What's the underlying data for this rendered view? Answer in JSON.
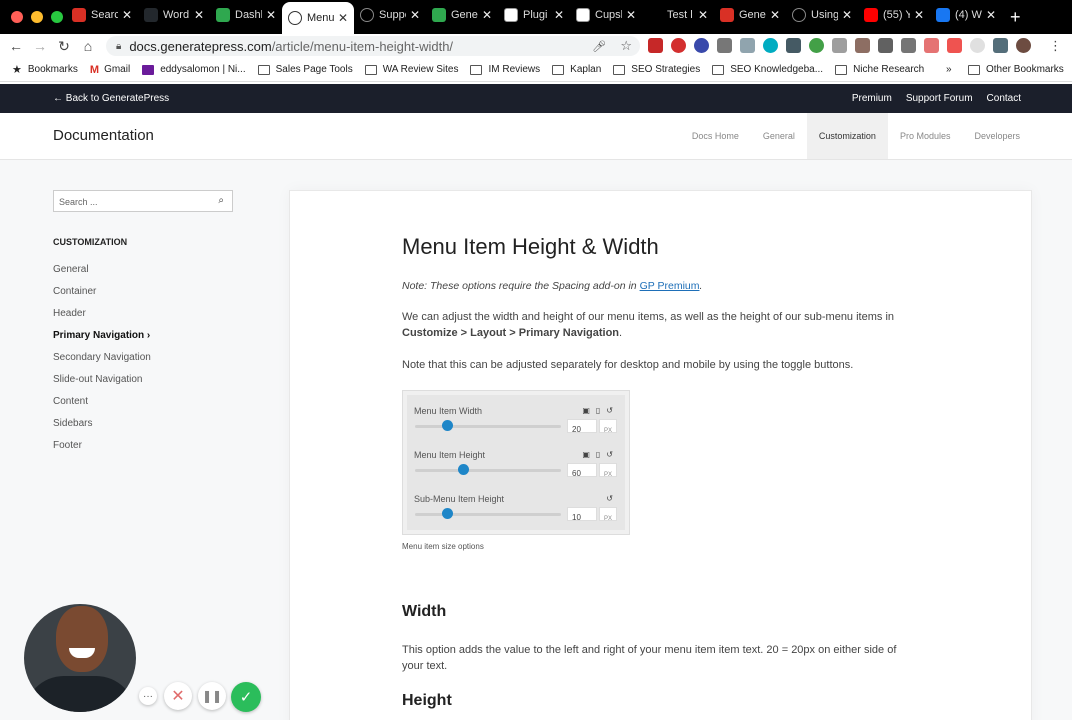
{
  "browser": {
    "tabs": [
      {
        "title": "Searc",
        "icon": "gmail-icon",
        "color": "#d93025"
      },
      {
        "title": "Word",
        "icon": "wordpress-icon",
        "color": "#23282d"
      },
      {
        "title": "Dashl",
        "icon": "dollar-icon",
        "color": "#2fa84f"
      },
      {
        "title": "Menu",
        "icon": "generatepress-icon",
        "color": "#333333",
        "active": true
      },
      {
        "title": "Suppo",
        "icon": "generatepress-icon",
        "color": "#333333"
      },
      {
        "title": "Gene",
        "icon": "dollar-icon",
        "color": "#2fa84f"
      },
      {
        "title": "Plugi",
        "icon": "wpx-icon",
        "color": "#ffffff"
      },
      {
        "title": "Cupsl",
        "icon": "wpx-icon",
        "color": "#ffffff"
      },
      {
        "title": "Test l",
        "icon": "blank-icon",
        "color": "#000000"
      },
      {
        "title": "Gene",
        "icon": "generate-icon",
        "color": "#d93025"
      },
      {
        "title": "Using",
        "icon": "generatepress-icon",
        "color": "#333333"
      },
      {
        "title": "(55) Y",
        "icon": "youtube-icon",
        "color": "#ff0000"
      },
      {
        "title": "(4) W",
        "icon": "facebook-icon",
        "color": "#1877f2"
      }
    ],
    "url_host": "docs.generatepress.com",
    "url_path": "/article/menu-item-height-width/",
    "bookmarks": [
      {
        "label": "Bookmarks",
        "icon": "star-icon"
      },
      {
        "label": "Gmail",
        "icon": "gmail-icon"
      },
      {
        "label": "eddysalomon | Ni...",
        "icon": "site-icon"
      },
      {
        "label": "Sales Page Tools",
        "icon": "folder-icon"
      },
      {
        "label": "WA Review Sites",
        "icon": "folder-icon"
      },
      {
        "label": "IM Reviews",
        "icon": "folder-icon"
      },
      {
        "label": "Kaplan",
        "icon": "folder-icon"
      },
      {
        "label": "SEO Strategies",
        "icon": "folder-icon"
      },
      {
        "label": "SEO Knowledgeba...",
        "icon": "folder-icon"
      },
      {
        "label": "Niche Research",
        "icon": "folder-icon"
      }
    ],
    "overflow": "»",
    "other_bookmarks": "Other Bookmarks"
  },
  "site": {
    "back_link": "← Back to GeneratePress",
    "top_links": [
      "Premium",
      "Support Forum",
      "Contact"
    ],
    "doc_title": "Documentation",
    "nav": [
      "Docs Home",
      "General",
      "Customization",
      "Pro Modules",
      "Developers"
    ],
    "nav_current": "Customization"
  },
  "sidebar": {
    "search_placeholder": "Search ...",
    "heading": "CUSTOMIZATION",
    "items": [
      "General",
      "Container",
      "Header",
      "Primary Navigation ›",
      "Secondary Navigation",
      "Slide-out Navigation",
      "Content",
      "Sidebars",
      "Footer"
    ],
    "current_index": 3
  },
  "article": {
    "title": "Menu Item Height & Width",
    "note_prefix": "Note: These options require the Spacing add-on in ",
    "note_link": "GP Premium",
    "note_suffix": ".",
    "p1_text": "We can adjust the width and height of our menu items, as well as the height of our sub-menu items in ",
    "p1_bold": "Customize > Layout > Primary Navigation",
    "p1_end": ".",
    "p2": "Note that this can be adjusted separately for desktop and mobile by using the toggle buttons.",
    "figure": {
      "rows": [
        {
          "label": "Menu Item Width",
          "value": "20",
          "unit": "PX",
          "slider_fraction": 0.22
        },
        {
          "label": "Menu Item Height",
          "value": "60",
          "unit": "PX",
          "slider_fraction": 0.33
        },
        {
          "label": "Sub-Menu Item Height",
          "value": "10",
          "unit": "PX",
          "slider_fraction": 0.22
        }
      ],
      "caption": "Menu item size options"
    },
    "h_width": "Width",
    "p3": "This option adds the value to the left and right of your menu item item text. 20 = 20px on either side of your text.",
    "h_height": "Height"
  },
  "recorder": {
    "more": "···",
    "cancel": "✕",
    "pause": "❚❚",
    "done": "✓"
  }
}
